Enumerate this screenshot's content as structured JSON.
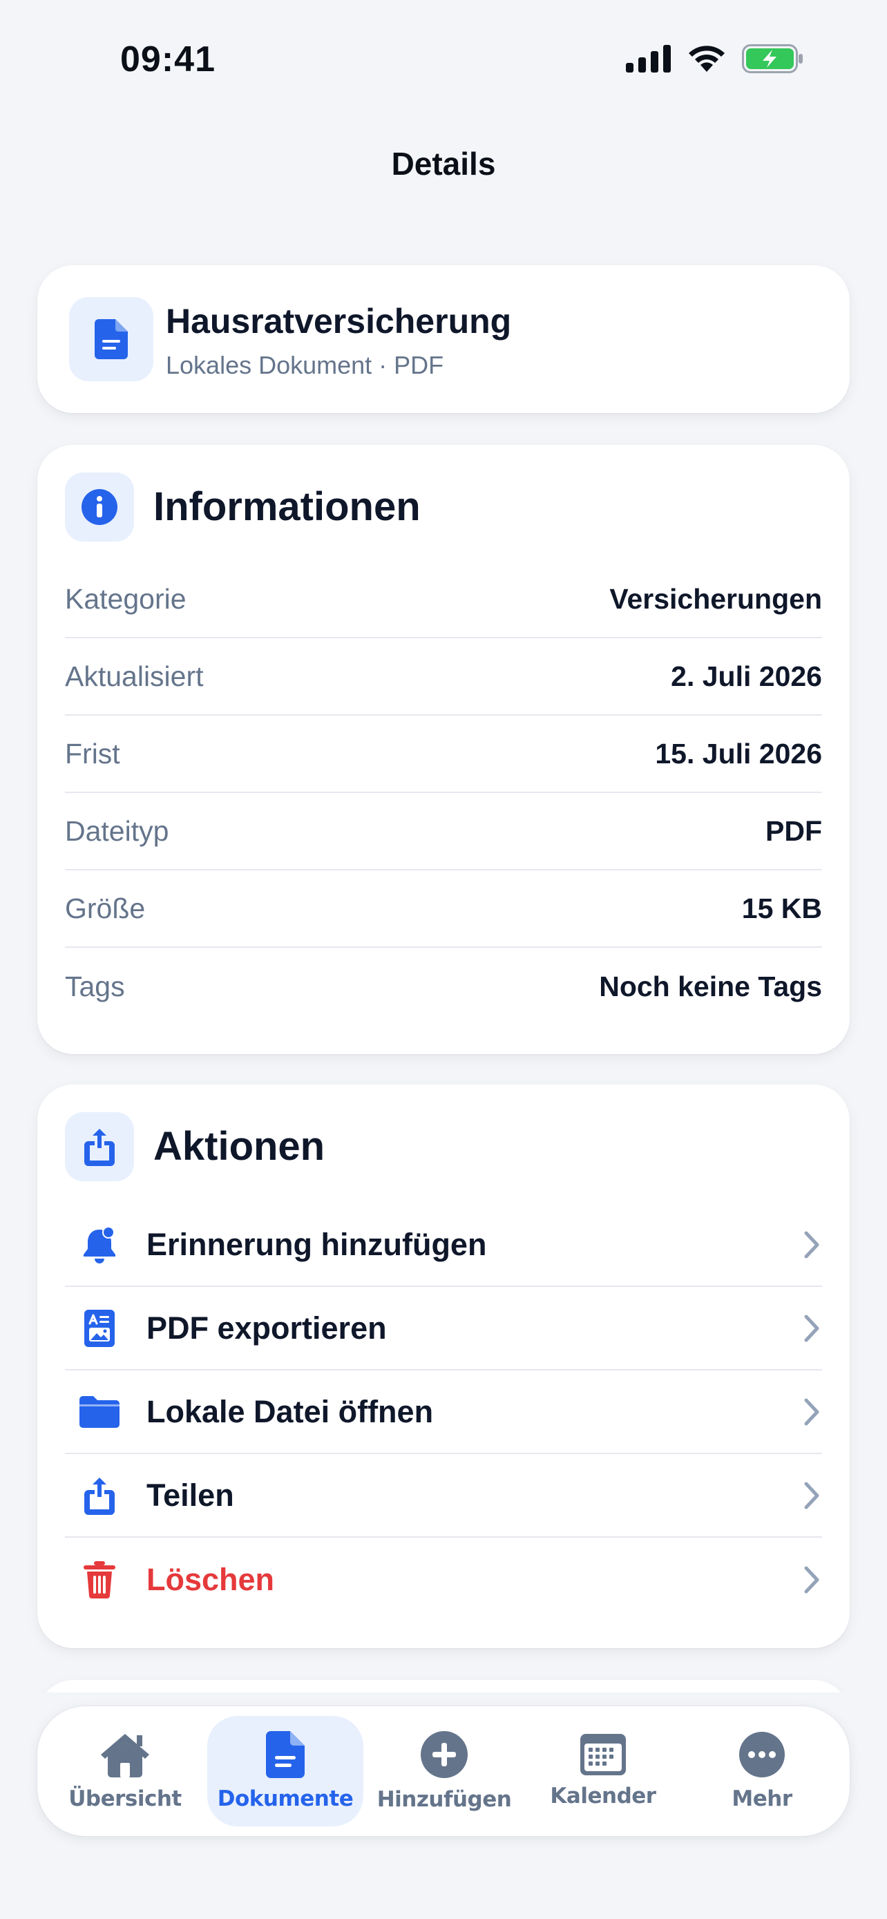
{
  "status_bar": {
    "time": "09:41"
  },
  "nav": {
    "title": "Details"
  },
  "document": {
    "title": "Hausratversicherung",
    "subtitle": "Lokales Dokument · PDF"
  },
  "info": {
    "title": "Informationen",
    "rows": [
      {
        "label": "Kategorie",
        "value": "Versicherungen"
      },
      {
        "label": "Aktualisiert",
        "value": "2. Juli 2026"
      },
      {
        "label": "Frist",
        "value": "15. Juli 2026"
      },
      {
        "label": "Dateityp",
        "value": "PDF"
      },
      {
        "label": "Größe",
        "value": "15 KB"
      },
      {
        "label": "Tags",
        "value": "Noch keine Tags"
      }
    ]
  },
  "actions": {
    "title": "Aktionen",
    "items": [
      {
        "label": "Erinnerung hinzufügen",
        "icon": "bell-badge-icon"
      },
      {
        "label": "PDF exportieren",
        "icon": "pdf-export-icon"
      },
      {
        "label": "Lokale Datei öffnen",
        "icon": "folder-icon"
      },
      {
        "label": "Teilen",
        "icon": "share-icon"
      },
      {
        "label": "Löschen",
        "icon": "trash-icon"
      }
    ]
  },
  "tabbar": {
    "tabs": [
      {
        "label": "Übersicht",
        "icon": "house-icon"
      },
      {
        "label": "Dokumente",
        "icon": "document-icon",
        "active": true
      },
      {
        "label": "Hinzufügen",
        "icon": "plus-circle-icon"
      },
      {
        "label": "Kalender",
        "icon": "calendar-icon"
      },
      {
        "label": "Mehr",
        "icon": "ellipsis-circle-icon"
      }
    ]
  },
  "colors": {
    "accent": "#2563eb",
    "danger": "#e5393b",
    "background": "#f3f5f8",
    "battery": "#34c759"
  }
}
